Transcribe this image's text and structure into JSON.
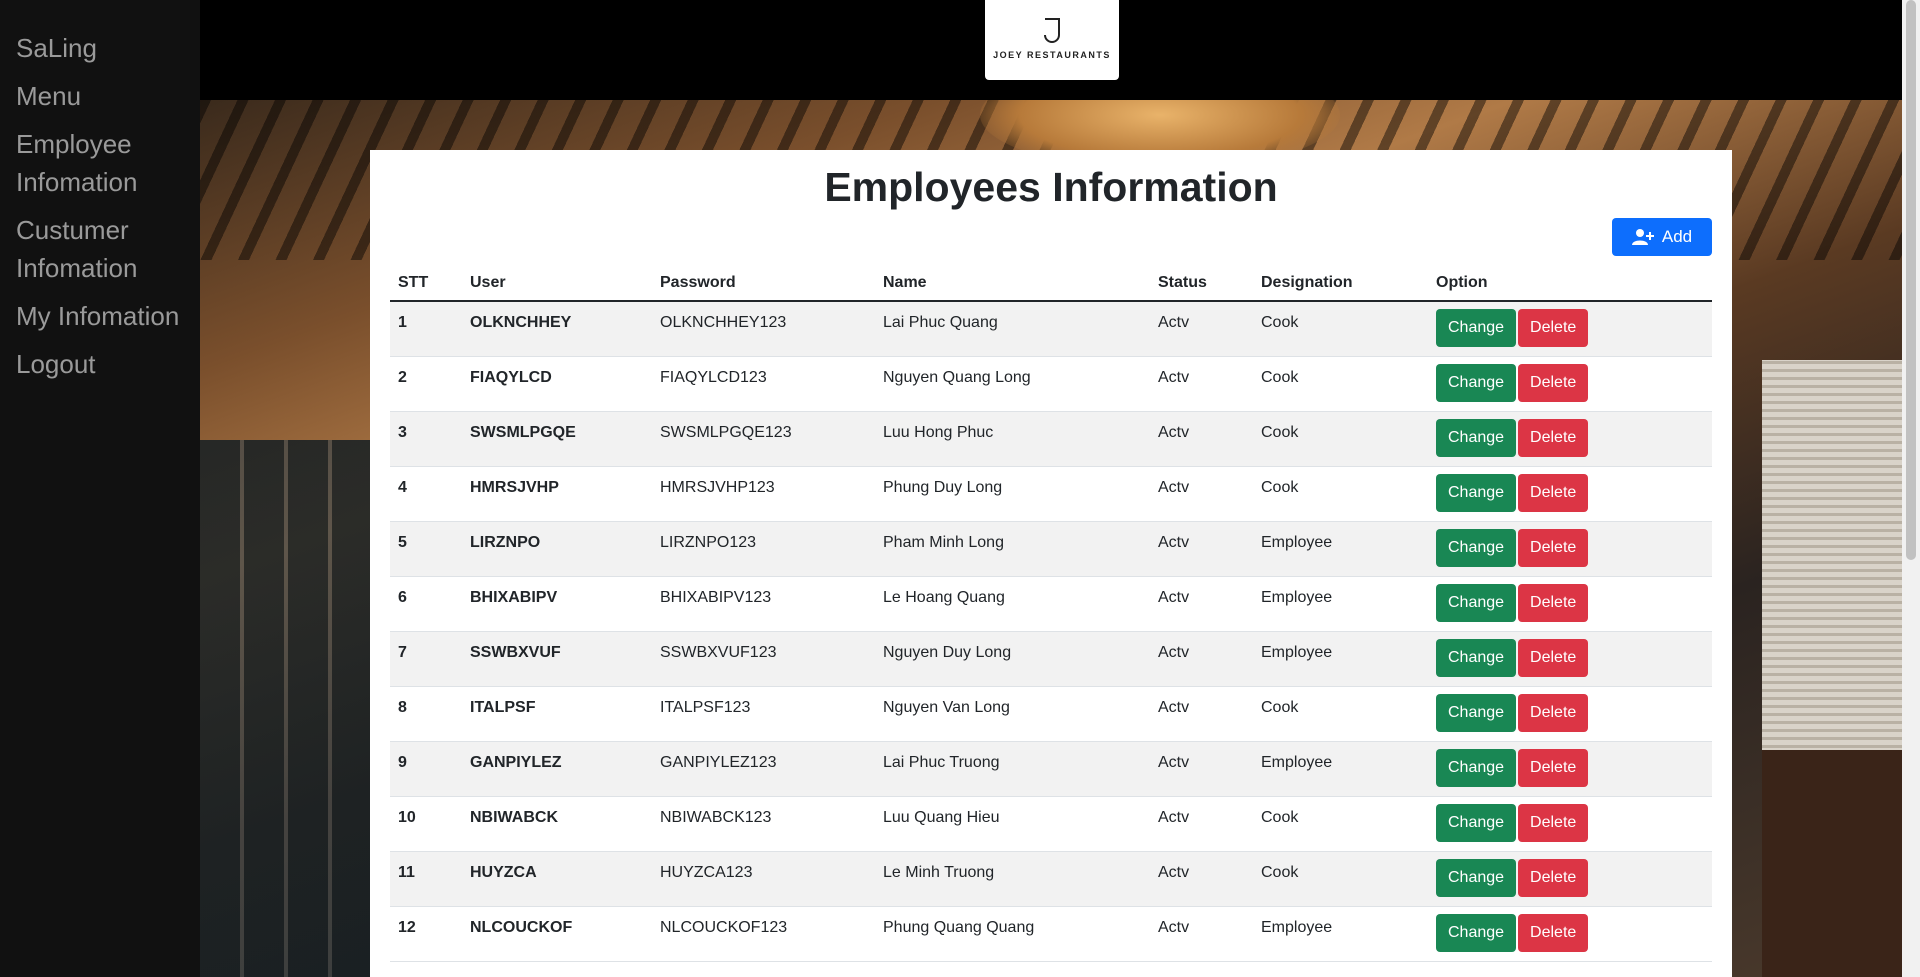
{
  "sidebar": {
    "items": [
      {
        "label": "SaLing"
      },
      {
        "label": "Menu"
      },
      {
        "label": "Employee Infomation"
      },
      {
        "label": "Custumer Infomation"
      },
      {
        "label": "My Infomation"
      },
      {
        "label": "Logout"
      }
    ]
  },
  "header": {
    "logo_text": "JOEY RESTAURANTS"
  },
  "main": {
    "title": "Employees Information",
    "add_label": "Add",
    "add_icon": "user-plus-icon",
    "columns": [
      "STT",
      "User",
      "Password",
      "Name",
      "Status",
      "Designation",
      "Option"
    ],
    "change_label": "Change",
    "delete_label": "Delete",
    "rows": [
      {
        "stt": "1",
        "user": "OLKNCHHEY",
        "password": "OLKNCHHEY123",
        "name": "Lai Phuc Quang",
        "status": "Actv",
        "designation": "Cook"
      },
      {
        "stt": "2",
        "user": "FIAQYLCD",
        "password": "FIAQYLCD123",
        "name": "Nguyen Quang Long",
        "status": "Actv",
        "designation": "Cook"
      },
      {
        "stt": "3",
        "user": "SWSMLPGQE",
        "password": "SWSMLPGQE123",
        "name": "Luu Hong Phuc",
        "status": "Actv",
        "designation": "Cook"
      },
      {
        "stt": "4",
        "user": "HMRSJVHP",
        "password": "HMRSJVHP123",
        "name": "Phung Duy Long",
        "status": "Actv",
        "designation": "Cook"
      },
      {
        "stt": "5",
        "user": "LIRZNPO",
        "password": "LIRZNPO123",
        "name": "Pham Minh Long",
        "status": "Actv",
        "designation": "Employee"
      },
      {
        "stt": "6",
        "user": "BHIXABIPV",
        "password": "BHIXABIPV123",
        "name": "Le Hoang Quang",
        "status": "Actv",
        "designation": "Employee"
      },
      {
        "stt": "7",
        "user": "SSWBXVUF",
        "password": "SSWBXVUF123",
        "name": "Nguyen Duy Long",
        "status": "Actv",
        "designation": "Employee"
      },
      {
        "stt": "8",
        "user": "ITALPSF",
        "password": "ITALPSF123",
        "name": "Nguyen Van Long",
        "status": "Actv",
        "designation": "Cook"
      },
      {
        "stt": "9",
        "user": "GANPIYLEZ",
        "password": "GANPIYLEZ123",
        "name": "Lai Phuc Truong",
        "status": "Actv",
        "designation": "Employee"
      },
      {
        "stt": "10",
        "user": "NBIWABCK",
        "password": "NBIWABCK123",
        "name": "Luu Quang Hieu",
        "status": "Actv",
        "designation": "Cook"
      },
      {
        "stt": "11",
        "user": "HUYZCA",
        "password": "HUYZCA123",
        "name": "Le Minh Truong",
        "status": "Actv",
        "designation": "Cook"
      },
      {
        "stt": "12",
        "user": "NLCOUCKOF",
        "password": "NLCOUCKOF123",
        "name": "Phung Quang Quang",
        "status": "Actv",
        "designation": "Employee"
      }
    ]
  },
  "colors": {
    "sidebar_bg": "#111111",
    "add_button": "#0d6efd",
    "change_button": "#198754",
    "delete_button": "#dc3545"
  }
}
